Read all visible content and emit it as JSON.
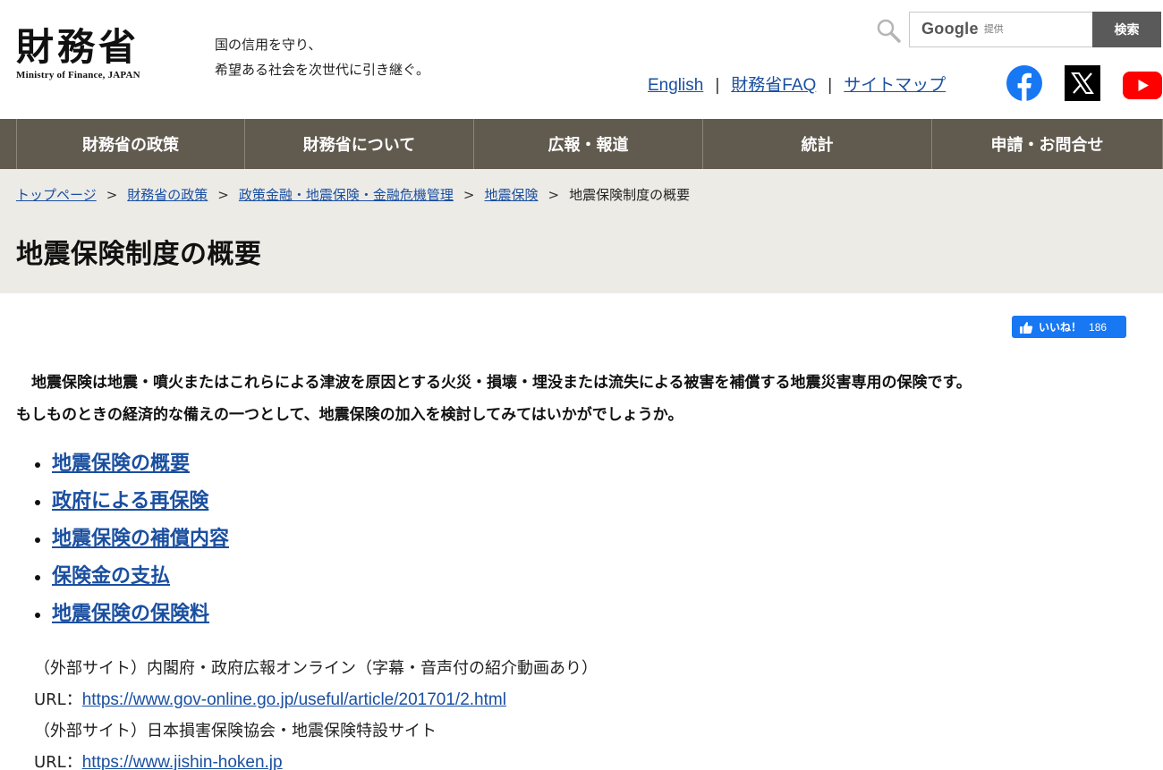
{
  "header": {
    "logo_jp": "財務省",
    "logo_en": "Ministry of Finance, JAPAN",
    "tagline_line1": "国の信用を守り、",
    "tagline_line2": "希望ある社会を次世代に引き継ぐ。"
  },
  "search": {
    "brand": "Google",
    "brand_suffix": "提供",
    "value": "",
    "button_label": "検索"
  },
  "util_links": {
    "english": "English",
    "faq": "財務省FAQ",
    "sitemap": "サイトマップ",
    "separator": "|"
  },
  "social": {
    "facebook_color": "#1877f2",
    "x_color": "#000000",
    "youtube_color": "#ff0000"
  },
  "gnav": [
    {
      "label": "財務省の政策"
    },
    {
      "label": "財務省について"
    },
    {
      "label": "広報・報道"
    },
    {
      "label": "統計"
    },
    {
      "label": "申請・お問合せ"
    }
  ],
  "breadcrumb": {
    "items": [
      "トップページ",
      "財務省の政策",
      "政策金融・地震保険・金融危機管理",
      "地震保険"
    ],
    "current": "地震保険制度の概要",
    "separator": ">"
  },
  "page_title": "地震保険制度の概要",
  "like": {
    "label": "いいね！",
    "count": "186"
  },
  "intro": {
    "line1": "　地震保険は地震・噴火またはこれらによる津波を原因とする火災・損壊・埋没または流失による被害を補償する地震災害専用の保険です。",
    "line2": "もしものときの経済的な備えの一つとして、地震保険の加入を検討してみてはいかがでしょうか。"
  },
  "menu": [
    "地震保険の概要",
    "政府による再保険",
    "地震保険の補償内容",
    "保険金の支払",
    "地震保険の保険料"
  ],
  "external": {
    "site1_label": "（外部サイト）内閣府・政府広報オンライン（字幕・音声付の紹介動画あり）",
    "url_prefix": "URL：",
    "site1_url": "https://www.gov-online.go.jp/useful/article/201701/2.html",
    "site2_label": "（外部サイト）日本損害保険協会・地震保険特設サイト",
    "site2_url": "https://www.jishin-hoken.jp"
  },
  "colors": {
    "nav_bg": "#615a4f",
    "title_bg": "#edebe6",
    "link": "#1a4fa0"
  }
}
